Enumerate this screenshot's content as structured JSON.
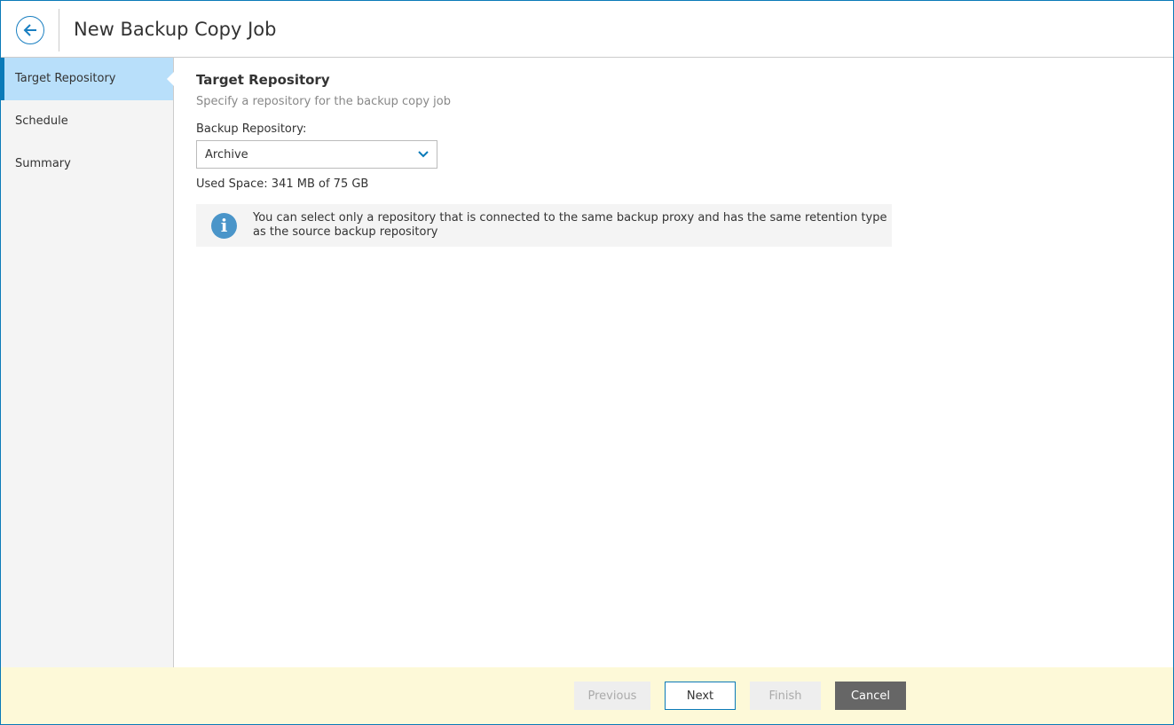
{
  "header": {
    "title": "New Backup Copy Job"
  },
  "steps": [
    {
      "label": "Target Repository"
    },
    {
      "label": "Schedule"
    },
    {
      "label": "Summary"
    }
  ],
  "main": {
    "heading": "Target Repository",
    "subtitle": "Specify a repository for the backup copy job",
    "repo_label": "Backup Repository:",
    "repo_value": "Archive",
    "used_space": "Used Space: 341 MB of 75 GB",
    "info": "You can select only a repository that is connected to the same backup proxy and has the same retention type as the source backup repository"
  },
  "footer": {
    "previous": "Previous",
    "next": "Next",
    "finish": "Finish",
    "cancel": "Cancel"
  },
  "colors": {
    "accent": "#0a7ab8",
    "active_step": "#b8dffa",
    "footer": "#fdf9d8",
    "cancel": "#666666"
  }
}
